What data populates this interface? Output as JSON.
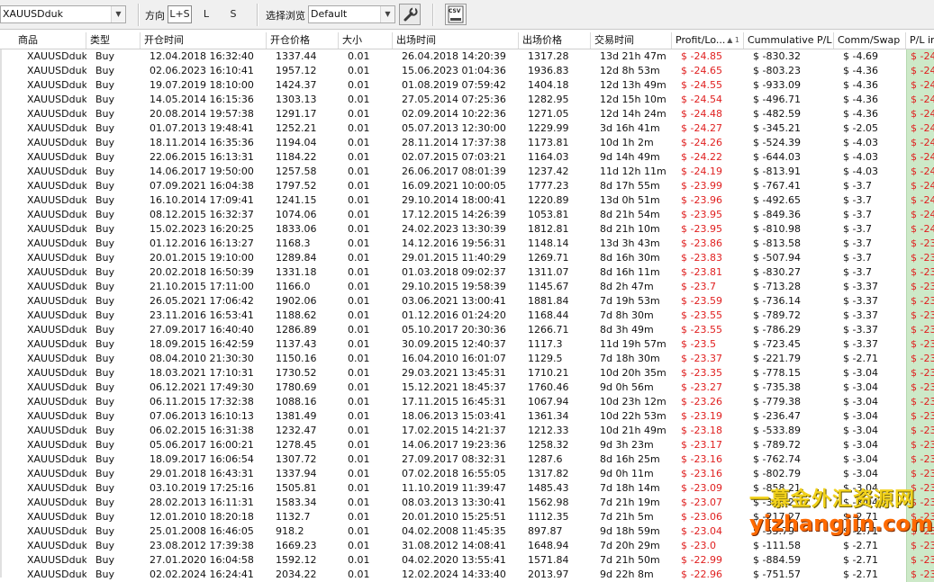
{
  "toolbar": {
    "symbol": "XAUUSDduk",
    "direction_label": "方向",
    "dir_ls": "L+S",
    "dir_l": "L",
    "dir_s": "S",
    "browse_label": "选择浏览",
    "browse_value": "Default",
    "csv_label": "CSV"
  },
  "columns": [
    "商品",
    "类型",
    "开仓时间",
    "开仓价格",
    "大小",
    "出场时间",
    "出场价格",
    "交易时间",
    "Profit/Lo...",
    "Cummulative P/L",
    "Comm/Swap",
    "P/L in"
  ],
  "sort_marker": "▲ 1",
  "rows": [
    [
      "XAUUSDduk",
      "Buy",
      "12.04.2018 16:32:40",
      "1337.44",
      "0.01",
      "26.04.2018 14:20:39",
      "1317.28",
      "13d 21h 47m",
      "$ -24.85",
      "$ -830.32",
      "$ -4.69",
      "$ -24"
    ],
    [
      "XAUUSDduk",
      "Buy",
      "02.06.2023 16:10:41",
      "1957.12",
      "0.01",
      "15.06.2023 01:04:36",
      "1936.83",
      "12d 8h 53m",
      "$ -24.65",
      "$ -803.23",
      "$ -4.36",
      "$ -24"
    ],
    [
      "XAUUSDduk",
      "Buy",
      "19.07.2019 18:10:00",
      "1424.37",
      "0.01",
      "01.08.2019 07:59:42",
      "1404.18",
      "12d 13h 49m",
      "$ -24.55",
      "$ -933.09",
      "$ -4.36",
      "$ -24"
    ],
    [
      "XAUUSDduk",
      "Buy",
      "14.05.2014 16:15:36",
      "1303.13",
      "0.01",
      "27.05.2014 07:25:36",
      "1282.95",
      "12d 15h 10m",
      "$ -24.54",
      "$ -496.71",
      "$ -4.36",
      "$ -24"
    ],
    [
      "XAUUSDduk",
      "Buy",
      "20.08.2014 19:57:38",
      "1291.17",
      "0.01",
      "02.09.2014 10:22:36",
      "1271.05",
      "12d 14h 24m",
      "$ -24.48",
      "$ -482.59",
      "$ -4.36",
      "$ -24"
    ],
    [
      "XAUUSDduk",
      "Buy",
      "01.07.2013 19:48:41",
      "1252.21",
      "0.01",
      "05.07.2013 12:30:00",
      "1229.99",
      "3d 16h 41m",
      "$ -24.27",
      "$ -345.21",
      "$ -2.05",
      "$ -24"
    ],
    [
      "XAUUSDduk",
      "Buy",
      "18.11.2014 16:35:36",
      "1194.04",
      "0.01",
      "28.11.2014 17:37:38",
      "1173.81",
      "10d 1h 2m",
      "$ -24.26",
      "$ -524.39",
      "$ -4.03",
      "$ -24"
    ],
    [
      "XAUUSDduk",
      "Buy",
      "22.06.2015 16:13:31",
      "1184.22",
      "0.01",
      "02.07.2015 07:03:21",
      "1164.03",
      "9d 14h 49m",
      "$ -24.22",
      "$ -644.03",
      "$ -4.03",
      "$ -24"
    ],
    [
      "XAUUSDduk",
      "Buy",
      "14.06.2017 19:50:00",
      "1257.58",
      "0.01",
      "26.06.2017 08:01:39",
      "1237.42",
      "11d 12h 11m",
      "$ -24.19",
      "$ -813.91",
      "$ -4.03",
      "$ -24"
    ],
    [
      "XAUUSDduk",
      "Buy",
      "07.09.2021 16:04:38",
      "1797.52",
      "0.01",
      "16.09.2021 10:00:05",
      "1777.23",
      "8d 17h 55m",
      "$ -23.99",
      "$ -767.41",
      "$ -3.7",
      "$ -24"
    ],
    [
      "XAUUSDduk",
      "Buy",
      "16.10.2014 17:09:41",
      "1241.15",
      "0.01",
      "29.10.2014 18:00:41",
      "1220.89",
      "13d 0h 51m",
      "$ -23.96",
      "$ -492.65",
      "$ -3.7",
      "$ -24"
    ],
    [
      "XAUUSDduk",
      "Buy",
      "08.12.2015 16:32:37",
      "1074.06",
      "0.01",
      "17.12.2015 14:26:39",
      "1053.81",
      "8d 21h 54m",
      "$ -23.95",
      "$ -849.36",
      "$ -3.7",
      "$ -24"
    ],
    [
      "XAUUSDduk",
      "Buy",
      "15.02.2023 16:20:25",
      "1833.06",
      "0.01",
      "24.02.2023 13:30:39",
      "1812.81",
      "8d 21h 10m",
      "$ -23.95",
      "$ -810.98",
      "$ -3.7",
      "$ -24"
    ],
    [
      "XAUUSDduk",
      "Buy",
      "01.12.2016 16:13:27",
      "1168.3",
      "0.01",
      "14.12.2016 19:56:31",
      "1148.14",
      "13d 3h 43m",
      "$ -23.86",
      "$ -813.58",
      "$ -3.7",
      "$ -23"
    ],
    [
      "XAUUSDduk",
      "Buy",
      "20.01.2015 19:10:00",
      "1289.84",
      "0.01",
      "29.01.2015 11:40:29",
      "1269.71",
      "8d 16h 30m",
      "$ -23.83",
      "$ -507.94",
      "$ -3.7",
      "$ -23"
    ],
    [
      "XAUUSDduk",
      "Buy",
      "20.02.2018 16:50:39",
      "1331.18",
      "0.01",
      "01.03.2018 09:02:37",
      "1311.07",
      "8d 16h 11m",
      "$ -23.81",
      "$ -830.27",
      "$ -3.7",
      "$ -23"
    ],
    [
      "XAUUSDduk",
      "Buy",
      "21.10.2015 17:11:00",
      "1166.0",
      "0.01",
      "29.10.2015 19:58:39",
      "1145.67",
      "8d 2h 47m",
      "$ -23.7",
      "$ -713.28",
      "$ -3.37",
      "$ -23"
    ],
    [
      "XAUUSDduk",
      "Buy",
      "26.05.2021 17:06:42",
      "1902.06",
      "0.01",
      "03.06.2021 13:00:41",
      "1881.84",
      "7d 19h 53m",
      "$ -23.59",
      "$ -736.14",
      "$ -3.37",
      "$ -23"
    ],
    [
      "XAUUSDduk",
      "Buy",
      "23.11.2016 16:53:41",
      "1188.62",
      "0.01",
      "01.12.2016 01:24:20",
      "1168.44",
      "7d 8h 30m",
      "$ -23.55",
      "$ -789.72",
      "$ -3.37",
      "$ -23"
    ],
    [
      "XAUUSDduk",
      "Buy",
      "27.09.2017 16:40:40",
      "1286.89",
      "0.01",
      "05.10.2017 20:30:36",
      "1266.71",
      "8d 3h 49m",
      "$ -23.55",
      "$ -786.29",
      "$ -3.37",
      "$ -23"
    ],
    [
      "XAUUSDduk",
      "Buy",
      "18.09.2015 16:42:59",
      "1137.43",
      "0.01",
      "30.09.2015 12:40:37",
      "1117.3",
      "11d 19h 57m",
      "$ -23.5",
      "$ -723.45",
      "$ -3.37",
      "$ -23"
    ],
    [
      "XAUUSDduk",
      "Buy",
      "08.04.2010 21:30:30",
      "1150.16",
      "0.01",
      "16.04.2010 16:01:07",
      "1129.5",
      "7d 18h 30m",
      "$ -23.37",
      "$ -221.79",
      "$ -2.71",
      "$ -23"
    ],
    [
      "XAUUSDduk",
      "Buy",
      "18.03.2021 17:10:31",
      "1730.52",
      "0.01",
      "29.03.2021 13:45:31",
      "1710.21",
      "10d 20h 35m",
      "$ -23.35",
      "$ -778.15",
      "$ -3.04",
      "$ -23"
    ],
    [
      "XAUUSDduk",
      "Buy",
      "06.12.2021 17:49:30",
      "1780.69",
      "0.01",
      "15.12.2021 18:45:37",
      "1760.46",
      "9d 0h 56m",
      "$ -23.27",
      "$ -735.38",
      "$ -3.04",
      "$ -23"
    ],
    [
      "XAUUSDduk",
      "Buy",
      "06.11.2015 17:32:38",
      "1088.16",
      "0.01",
      "17.11.2015 16:45:31",
      "1067.94",
      "10d 23h 12m",
      "$ -23.26",
      "$ -779.38",
      "$ -3.04",
      "$ -23"
    ],
    [
      "XAUUSDduk",
      "Buy",
      "07.06.2013 16:10:13",
      "1381.49",
      "0.01",
      "18.06.2013 15:03:41",
      "1361.34",
      "10d 22h 53m",
      "$ -23.19",
      "$ -236.47",
      "$ -3.04",
      "$ -23"
    ],
    [
      "XAUUSDduk",
      "Buy",
      "06.02.2015 16:31:38",
      "1232.47",
      "0.01",
      "17.02.2015 14:21:37",
      "1212.33",
      "10d 21h 49m",
      "$ -23.18",
      "$ -533.89",
      "$ -3.04",
      "$ -23"
    ],
    [
      "XAUUSDduk",
      "Buy",
      "05.06.2017 16:00:21",
      "1278.45",
      "0.01",
      "14.06.2017 19:23:36",
      "1258.32",
      "9d 3h 23m",
      "$ -23.17",
      "$ -789.72",
      "$ -3.04",
      "$ -23"
    ],
    [
      "XAUUSDduk",
      "Buy",
      "18.09.2017 16:06:54",
      "1307.72",
      "0.01",
      "27.09.2017 08:32:31",
      "1287.6",
      "8d 16h 25m",
      "$ -23.16",
      "$ -762.74",
      "$ -3.04",
      "$ -23"
    ],
    [
      "XAUUSDduk",
      "Buy",
      "29.01.2018 16:43:31",
      "1337.94",
      "0.01",
      "07.02.2018 16:55:05",
      "1317.82",
      "9d 0h 11m",
      "$ -23.16",
      "$ -802.79",
      "$ -3.04",
      "$ -23"
    ],
    [
      "XAUUSDduk",
      "Buy",
      "03.10.2019 17:25:16",
      "1505.81",
      "0.01",
      "11.10.2019 11:39:47",
      "1485.43",
      "7d 18h 14m",
      "$ -23.09",
      "$ -858.21",
      "$ -3.04",
      "$ -23"
    ],
    [
      "XAUUSDduk",
      "Buy",
      "28.02.2013 16:11:31",
      "1583.34",
      "0.01",
      "08.03.2013 13:30:41",
      "1562.98",
      "7d 21h 19m",
      "$ -23.07",
      "$ -345.21",
      "$ -3.04",
      "$ -23"
    ],
    [
      "XAUUSDduk",
      "Buy",
      "12.01.2010 18:20:18",
      "1132.7",
      "0.01",
      "20.01.2010 15:25:51",
      "1112.35",
      "7d 21h 5m",
      "$ -23.06",
      "$ -217.27",
      "$ -2.71",
      "$ -23"
    ],
    [
      "XAUUSDduk",
      "Buy",
      "25.01.2008 16:46:05",
      "918.2",
      "0.01",
      "04.02.2008 11:45:35",
      "897.87",
      "9d 18h 59m",
      "$ -23.04",
      "$ -55.79",
      "$ -2.71",
      "$ -23"
    ],
    [
      "XAUUSDduk",
      "Buy",
      "23.08.2012 17:39:38",
      "1669.23",
      "0.01",
      "31.08.2012 14:08:41",
      "1648.94",
      "7d 20h 29m",
      "$ -23.0",
      "$ -111.58",
      "$ -2.71",
      "$ -23"
    ],
    [
      "XAUUSDduk",
      "Buy",
      "27.01.2020 16:04:58",
      "1592.12",
      "0.01",
      "04.02.2020 13:55:41",
      "1571.84",
      "7d 21h 50m",
      "$ -22.99",
      "$ -884.59",
      "$ -2.71",
      "$ -23"
    ],
    [
      "XAUUSDduk",
      "Buy",
      "02.02.2024 16:24:41",
      "2034.22",
      "0.01",
      "12.02.2024 14:33:40",
      "2013.97",
      "9d 22h 8m",
      "$ -22.96",
      "$ -751.57",
      "$ -2.71",
      "$ -23"
    ]
  ],
  "watermark": {
    "line1": "一慕金外汇资源网",
    "line2": "yizhangjin.com"
  },
  "colors": {
    "loss": "#e02020",
    "pl_in_bg": "#cde9c8"
  }
}
